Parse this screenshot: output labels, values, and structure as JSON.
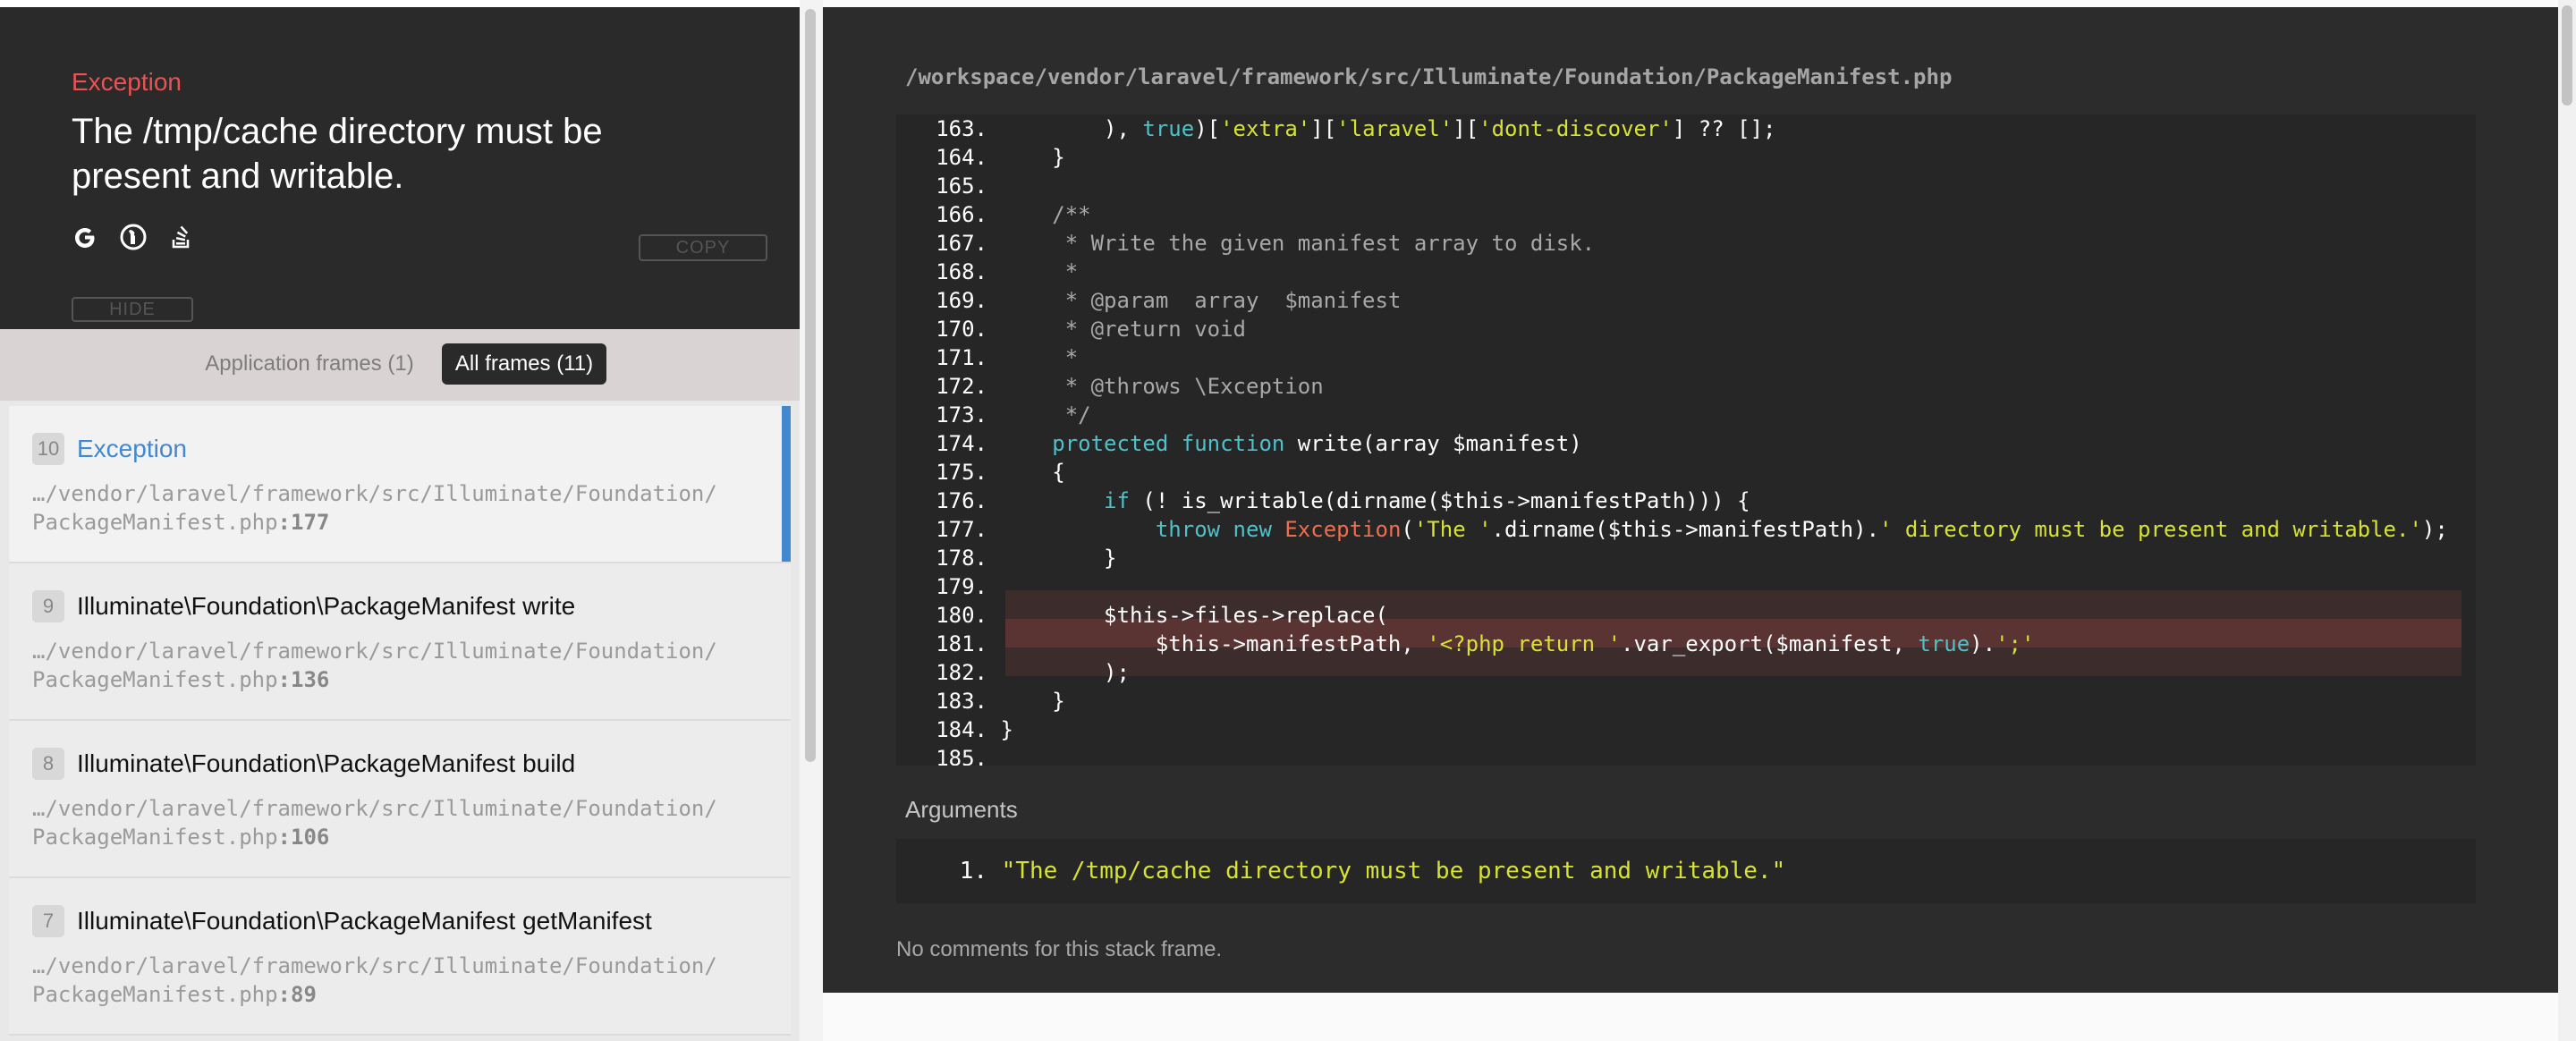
{
  "header": {
    "exception_type": "Exception",
    "exception_message": "The /tmp/cache directory must be present and writable.",
    "icons": [
      "google-icon",
      "duckduckgo-icon",
      "stack-overflow-icon"
    ],
    "copy_label": "COPY",
    "hide_label": "HIDE"
  },
  "filters": {
    "application_frames": "Application frames (1)",
    "all_frames": "All frames (11)"
  },
  "frames": [
    {
      "index": "10",
      "title": "Exception",
      "path": "…/vendor/laravel/framework/src/Illuminate/Foundation/",
      "file": "PackageManifest.php",
      "line": ":177",
      "active": true
    },
    {
      "index": "9",
      "title": "Illuminate\\Foundation\\PackageManifest write",
      "path": "…/vendor/laravel/framework/src/Illuminate/Foundation/",
      "file": "PackageManifest.php",
      "line": ":136",
      "active": false
    },
    {
      "index": "8",
      "title": "Illuminate\\Foundation\\PackageManifest build",
      "path": "…/vendor/laravel/framework/src/Illuminate/Foundation/",
      "file": "PackageManifest.php",
      "line": ":106",
      "active": false
    },
    {
      "index": "7",
      "title": "Illuminate\\Foundation\\PackageManifest getManifest",
      "path": "…/vendor/laravel/framework/src/Illuminate/Foundation/",
      "file": "PackageManifest.php",
      "line": ":89",
      "active": false
    }
  ],
  "code": {
    "file_path": "/workspace/vendor/laravel/framework/src/Illuminate/Foundation/PackageManifest.php",
    "highlighted_line": 177,
    "lines": [
      {
        "n": "163.",
        "segs": [
          [
            "",
            "        ), "
          ],
          [
            "kw",
            "true"
          ],
          [
            "",
            ")["
          ],
          [
            "str",
            "'extra'"
          ],
          [
            "",
            "]["
          ],
          [
            "str",
            "'laravel'"
          ],
          [
            "",
            "]["
          ],
          [
            "str",
            "'dont-discover'"
          ],
          [
            "",
            "] ?? [];"
          ]
        ]
      },
      {
        "n": "164.",
        "segs": [
          [
            "",
            "    }"
          ]
        ]
      },
      {
        "n": "165.",
        "segs": [
          [
            "",
            ""
          ]
        ]
      },
      {
        "n": "166.",
        "segs": [
          [
            "com",
            "    /**"
          ]
        ]
      },
      {
        "n": "167.",
        "segs": [
          [
            "com",
            "     * Write the given manifest array to disk."
          ]
        ]
      },
      {
        "n": "168.",
        "segs": [
          [
            "com",
            "     *"
          ]
        ]
      },
      {
        "n": "169.",
        "segs": [
          [
            "com",
            "     * @param  array  $manifest"
          ]
        ]
      },
      {
        "n": "170.",
        "segs": [
          [
            "com",
            "     * @return void"
          ]
        ]
      },
      {
        "n": "171.",
        "segs": [
          [
            "com",
            "     *"
          ]
        ]
      },
      {
        "n": "172.",
        "segs": [
          [
            "com",
            "     * @throws \\Exception"
          ]
        ]
      },
      {
        "n": "173.",
        "segs": [
          [
            "com",
            "     */"
          ]
        ]
      },
      {
        "n": "174.",
        "segs": [
          [
            "",
            "    "
          ],
          [
            "kw",
            "protected function"
          ],
          [
            "",
            " write(array $manifest)"
          ]
        ]
      },
      {
        "n": "175.",
        "segs": [
          [
            "",
            "    {"
          ]
        ]
      },
      {
        "n": "176.",
        "segs": [
          [
            "",
            "        "
          ],
          [
            "kw",
            "if"
          ],
          [
            "",
            " (! is_writable(dirname($this->manifestPath))) {"
          ]
        ]
      },
      {
        "n": "177.",
        "segs": [
          [
            "",
            "            "
          ],
          [
            "kw",
            "throw new"
          ],
          [
            "",
            " "
          ],
          [
            "exc",
            "Exception"
          ],
          [
            "",
            "("
          ],
          [
            "str",
            "'The '"
          ],
          [
            "",
            ".dirname($this->manifestPath)."
          ],
          [
            "str",
            "' directory must be present and writable.'"
          ],
          [
            "",
            ");"
          ]
        ]
      },
      {
        "n": "178.",
        "segs": [
          [
            "",
            "        }"
          ]
        ]
      },
      {
        "n": "179.",
        "segs": [
          [
            "",
            ""
          ]
        ]
      },
      {
        "n": "180.",
        "segs": [
          [
            "",
            "        $this->files->replace("
          ]
        ]
      },
      {
        "n": "181.",
        "segs": [
          [
            "",
            "            $this->manifestPath, "
          ],
          [
            "str",
            "'<?php return '"
          ],
          [
            "",
            ".var_export($manifest, "
          ],
          [
            "kw",
            "true"
          ],
          [
            "",
            ")."
          ],
          [
            "str",
            "';'"
          ]
        ]
      },
      {
        "n": "182.",
        "segs": [
          [
            "",
            "        );"
          ]
        ]
      },
      {
        "n": "183.",
        "segs": [
          [
            "",
            "    }"
          ]
        ]
      },
      {
        "n": "184.",
        "segs": [
          [
            "",
            "}"
          ]
        ]
      },
      {
        "n": "185.",
        "segs": [
          [
            "",
            ""
          ]
        ]
      }
    ]
  },
  "arguments": {
    "label": "Arguments",
    "items": [
      {
        "n": "1.",
        "value": "\"The /tmp/cache directory must be present and writable.\""
      }
    ]
  },
  "comments": {
    "text": "No comments for this stack frame."
  },
  "colors": {
    "exception_red": "#e95353",
    "active_blue": "#4288ce",
    "keyword": "#4ec1c9",
    "string": "#d6e336",
    "highlight": "#5a3433"
  }
}
